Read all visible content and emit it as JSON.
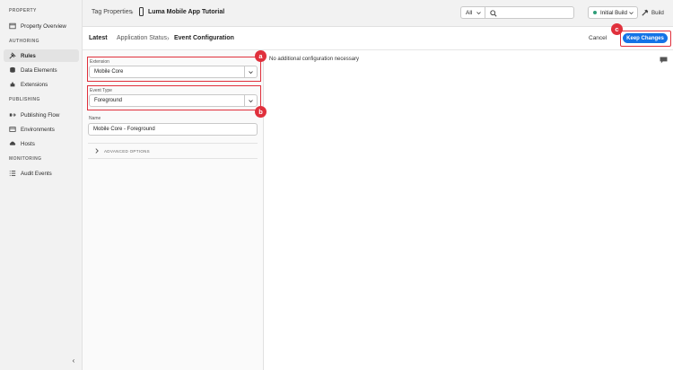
{
  "sidebar": {
    "sections": [
      {
        "heading": "PROPERTY"
      },
      {
        "heading": "AUTHORING"
      },
      {
        "heading": "PUBLISHING"
      },
      {
        "heading": "MONITORING"
      }
    ],
    "items": [
      {
        "label": "Property Overview",
        "icon": "property-overview-icon"
      },
      {
        "label": "Rules",
        "icon": "rules-icon",
        "active": true
      },
      {
        "label": "Data Elements",
        "icon": "data-elements-icon"
      },
      {
        "label": "Extensions",
        "icon": "extensions-icon"
      },
      {
        "label": "Publishing Flow",
        "icon": "publishing-flow-icon"
      },
      {
        "label": "Environments",
        "icon": "environments-icon"
      },
      {
        "label": "Hosts",
        "icon": "hosts-icon"
      },
      {
        "label": "Audit Events",
        "icon": "audit-events-icon"
      }
    ],
    "collapse_glyph": "‹"
  },
  "topbar": {
    "crumb_root": "Tag Properties",
    "crumb_property": "Luma Mobile App Tutorial",
    "separator": "›",
    "filter_value": "All",
    "search_placeholder": "",
    "build_status": "Initial Build",
    "build_label": "Build",
    "status_color": "#2d9d78"
  },
  "header": {
    "latest": "Latest",
    "crumb_parent": "Application Status",
    "crumb_current": "Event Configuration",
    "separator": "›",
    "cancel_label": "Cancel",
    "keep_label": "Keep Changes",
    "accent": "#1473e6"
  },
  "form": {
    "extension_label": "Extension",
    "extension_value": "Mobile Core",
    "event_type_label": "Event Type",
    "event_type_value": "Foreground",
    "name_label": "Name",
    "name_value": "Mobile Core - Foreground",
    "advanced_label": "ADVANCED OPTIONS"
  },
  "config": {
    "message": "No additional configuration necessary"
  },
  "callouts": {
    "a": "a",
    "b": "b",
    "c": "c",
    "color": "#e0303c"
  }
}
